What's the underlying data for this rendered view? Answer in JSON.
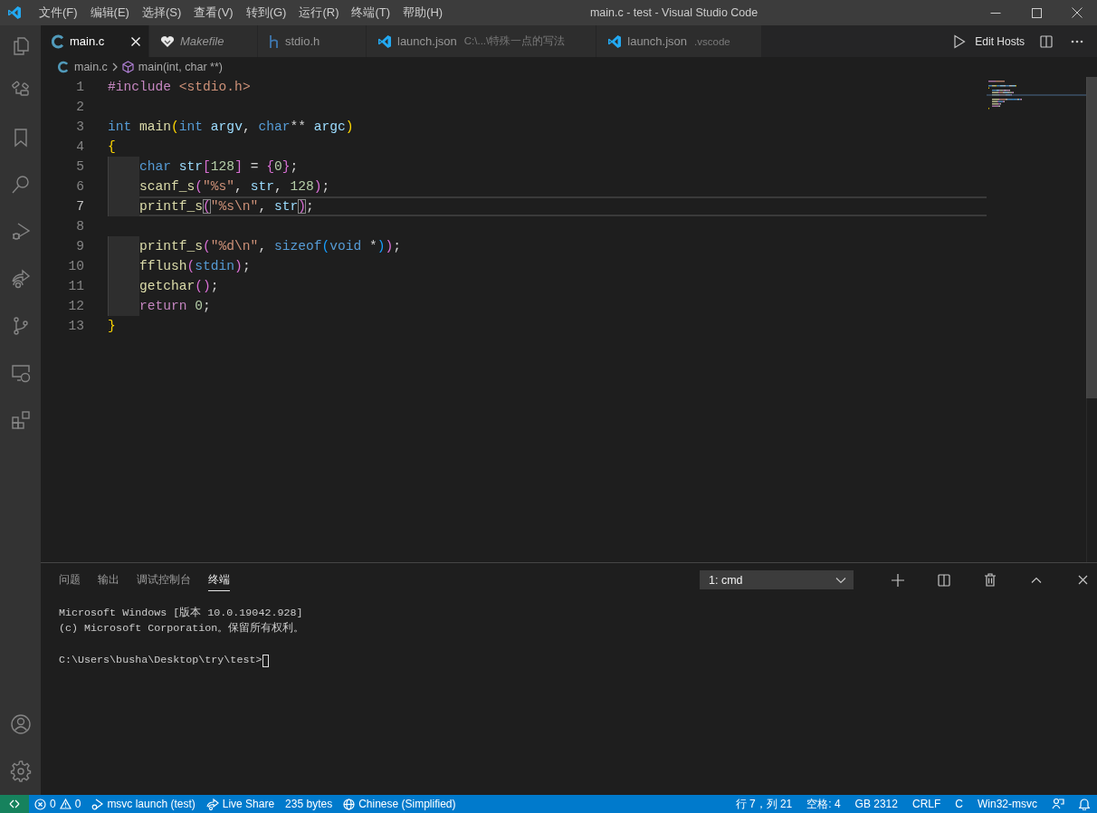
{
  "window": {
    "title": "main.c - test - Visual Studio Code"
  },
  "menu": [
    "文件(F)",
    "编辑(E)",
    "选择(S)",
    "查看(V)",
    "转到(G)",
    "运行(R)",
    "终端(T)",
    "帮助(H)"
  ],
  "tabs": [
    {
      "label": "main.c",
      "kind": "c",
      "selected": true,
      "preview": false
    },
    {
      "label": "Makefile",
      "kind": "makefile",
      "selected": false,
      "preview": true
    },
    {
      "label": "stdio.h",
      "kind": "h",
      "selected": false,
      "preview": false
    },
    {
      "label": "launch.json",
      "kind": "vscode",
      "selected": false,
      "preview": false,
      "description": "C:\\...\\特殊一点的写法"
    },
    {
      "label": "launch.json",
      "kind": "vscode",
      "selected": false,
      "preview": false,
      "description": ".vscode"
    }
  ],
  "editor_actions": {
    "label": "Edit Hosts"
  },
  "breadcrumb": [
    {
      "label": "main.c",
      "kind": "file"
    },
    {
      "label": "main(int, char **)",
      "kind": "function"
    }
  ],
  "code": {
    "lines": [
      {
        "number": "1",
        "indent": false,
        "current": false,
        "tokens": [
          {
            "t": "#include",
            "kind": "pre"
          },
          {
            "t": " <stdio.h>",
            "kind": "str"
          }
        ]
      },
      {
        "number": "2",
        "indent": false,
        "current": false
      },
      {
        "number": "3",
        "indent": false,
        "current": false,
        "tokens": [
          {
            "t": "int ",
            "kind": "kw"
          },
          {
            "t": "main",
            "kind": "fn"
          },
          {
            "t": "(",
            "kind": "b1"
          },
          {
            "t": "int ",
            "kind": "kw"
          },
          {
            "t": "argv",
            "kind": "var"
          },
          {
            "t": ", ",
            "kind": "plain"
          },
          {
            "t": "char",
            "kind": "kw"
          },
          {
            "t": "** ",
            "kind": "plain"
          },
          {
            "t": "argc",
            "kind": "var"
          },
          {
            "t": ")",
            "kind": "b1"
          }
        ]
      },
      {
        "number": "4",
        "indent": false,
        "current": false,
        "tokens": [
          {
            "t": "{",
            "kind": "b1"
          }
        ]
      },
      {
        "number": "5",
        "indent": true,
        "current": false,
        "tokens": [
          {
            "t": "char ",
            "kind": "kw"
          },
          {
            "t": "str",
            "kind": "var"
          },
          {
            "t": "[",
            "kind": "b2"
          },
          {
            "t": "128",
            "kind": "num"
          },
          {
            "t": "]",
            "kind": "b2"
          },
          {
            "t": " = ",
            "kind": "plain"
          },
          {
            "t": "{",
            "kind": "b2"
          },
          {
            "t": "0",
            "kind": "num"
          },
          {
            "t": "}",
            "kind": "b2"
          },
          {
            "t": ";",
            "kind": "plain"
          }
        ]
      },
      {
        "number": "6",
        "indent": true,
        "current": false,
        "tokens": [
          {
            "t": "scanf_s",
            "kind": "fn"
          },
          {
            "t": "(",
            "kind": "b2"
          },
          {
            "t": "\"%s\"",
            "kind": "str"
          },
          {
            "t": ", ",
            "kind": "plain"
          },
          {
            "t": "str",
            "kind": "var"
          },
          {
            "t": ", ",
            "kind": "plain"
          },
          {
            "t": "128",
            "kind": "num"
          },
          {
            "t": ")",
            "kind": "b2"
          },
          {
            "t": ";",
            "kind": "plain"
          }
        ]
      },
      {
        "number": "7",
        "indent": true,
        "current": true,
        "tokens": [
          {
            "t": "printf_s",
            "kind": "fn"
          },
          {
            "t": "(",
            "kind": "b2box"
          },
          {
            "t": "\"%s\\n\"",
            "kind": "str"
          },
          {
            "t": ", ",
            "kind": "plain"
          },
          {
            "t": "str",
            "kind": "var"
          },
          {
            "t": ")",
            "kind": "b2box"
          },
          {
            "t": ";",
            "kind": "plain"
          }
        ]
      },
      {
        "number": "8",
        "indent": false,
        "current": false
      },
      {
        "number": "9",
        "indent": true,
        "current": false,
        "tokens": [
          {
            "t": "printf_s",
            "kind": "fn"
          },
          {
            "t": "(",
            "kind": "b2"
          },
          {
            "t": "\"%d\\n\"",
            "kind": "str"
          },
          {
            "t": ", ",
            "kind": "plain"
          },
          {
            "t": "sizeof",
            "kind": "kw"
          },
          {
            "t": "(",
            "kind": "b3"
          },
          {
            "t": "void",
            "kind": "kw"
          },
          {
            "t": " *",
            "kind": "plain"
          },
          {
            "t": ")",
            "kind": "b3"
          },
          {
            "t": ")",
            "kind": "b2"
          },
          {
            "t": ";",
            "kind": "plain"
          }
        ]
      },
      {
        "number": "10",
        "indent": true,
        "current": false,
        "tokens": [
          {
            "t": "fflush",
            "kind": "fn"
          },
          {
            "t": "(",
            "kind": "b2"
          },
          {
            "t": "stdin",
            "kind": "kw"
          },
          {
            "t": ")",
            "kind": "b2"
          },
          {
            "t": ";",
            "kind": "plain"
          }
        ]
      },
      {
        "number": "11",
        "indent": true,
        "current": false,
        "tokens": [
          {
            "t": "getchar",
            "kind": "fn"
          },
          {
            "t": "(",
            "kind": "b2"
          },
          {
            "t": ")",
            "kind": "b2"
          },
          {
            "t": ";",
            "kind": "plain"
          }
        ]
      },
      {
        "number": "12",
        "indent": true,
        "current": false,
        "tokens": [
          {
            "t": "return ",
            "kind": "ctl"
          },
          {
            "t": "0",
            "kind": "num"
          },
          {
            "t": ";",
            "kind": "plain"
          }
        ]
      },
      {
        "number": "13",
        "indent": false,
        "current": false,
        "tokens": [
          {
            "t": "}",
            "kind": "b1"
          }
        ]
      }
    ]
  },
  "panel": {
    "tabs": [
      {
        "label": "问题",
        "selected": false
      },
      {
        "label": "输出",
        "selected": false
      },
      {
        "label": "调试控制台",
        "selected": false
      },
      {
        "label": "终端",
        "selected": true
      }
    ],
    "terminal_select": "1: cmd",
    "output": [
      "Microsoft Windows [版本 10.0.19042.928]",
      "(c) Microsoft Corporation。保留所有权利。"
    ],
    "prompt": "C:\\Users\\busha\\Desktop\\try\\test>"
  },
  "status_bar": {
    "left": [
      {
        "kind": "remote"
      },
      {
        "kind": "problems",
        "errors": "0",
        "warnings": "0"
      },
      {
        "kind": "debug",
        "label": "msvc launch (test)"
      },
      {
        "kind": "liveshare",
        "label": "Live Share"
      },
      {
        "kind": "text",
        "label": "235 bytes"
      },
      {
        "kind": "language",
        "label": "Chinese (Simplified)"
      }
    ],
    "right": [
      {
        "kind": "text",
        "label": "行 7，列 21"
      },
      {
        "kind": "text",
        "label": "空格: 4"
      },
      {
        "kind": "text",
        "label": "GB 2312"
      },
      {
        "kind": "text",
        "label": "CRLF"
      },
      {
        "kind": "text",
        "label": "C"
      },
      {
        "kind": "text",
        "label": "Win32-msvc"
      },
      {
        "kind": "feedback"
      },
      {
        "kind": "bell"
      }
    ]
  }
}
